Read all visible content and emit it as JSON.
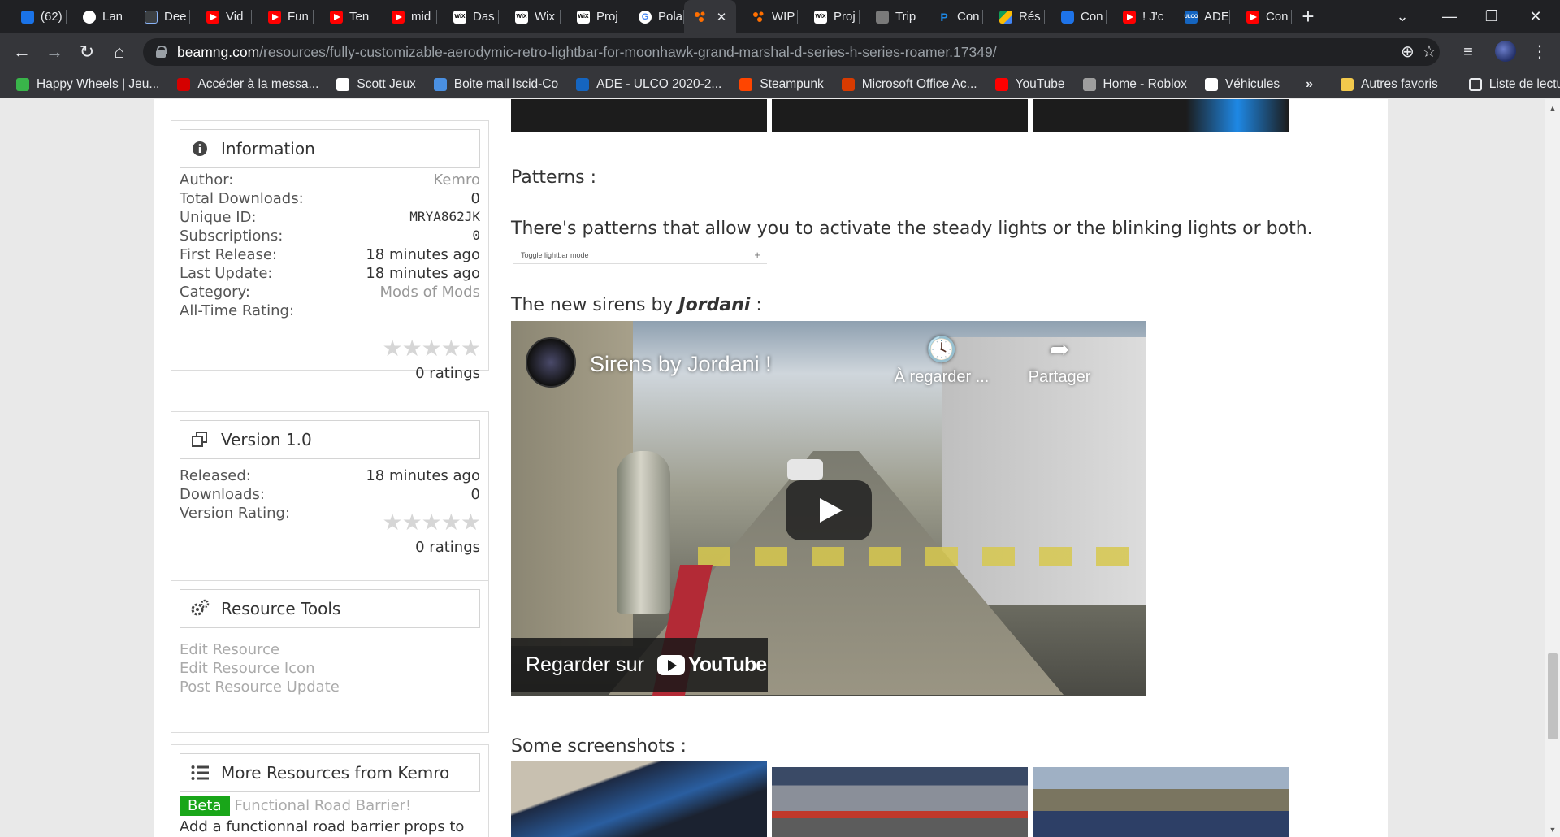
{
  "tabs": [
    {
      "label": "(62)",
      "icon": "avatar-icon",
      "cls": "fi-blue"
    },
    {
      "label": "Lan",
      "icon": "globe-icon",
      "cls": "fi-globe"
    },
    {
      "label": "Dee",
      "icon": "deepl-icon",
      "cls": "fi-dark"
    },
    {
      "label": "Vid",
      "icon": "youtube-icon",
      "cls": "fi-yt"
    },
    {
      "label": "Fun",
      "icon": "youtube-icon",
      "cls": "fi-yt"
    },
    {
      "label": "Ten",
      "icon": "youtube-icon",
      "cls": "fi-yt"
    },
    {
      "label": "mid",
      "icon": "youtube-icon",
      "cls": "fi-yt"
    },
    {
      "label": "Das",
      "icon": "wix-icon",
      "cls": "fi-wix"
    },
    {
      "label": "Wix",
      "icon": "wix-icon",
      "cls": "fi-wix"
    },
    {
      "label": "Proj",
      "icon": "wix-icon",
      "cls": "fi-wix"
    },
    {
      "label": "Pola",
      "icon": "google-icon",
      "cls": "fi-g"
    },
    {
      "label": "",
      "icon": "beamng-icon",
      "cls": "fi-orange",
      "active": true
    },
    {
      "label": "WIP",
      "icon": "beamng-icon",
      "cls": "fi-orange"
    },
    {
      "label": "Proj",
      "icon": "wix-icon",
      "cls": "fi-wix"
    },
    {
      "label": "Trip",
      "icon": "trip-icon",
      "cls": "fi-trip"
    },
    {
      "label": "Con",
      "icon": "paypal-icon",
      "cls": "fi-pp"
    },
    {
      "label": "Rés",
      "icon": "drive-icon",
      "cls": "fi-drive"
    },
    {
      "label": "Con",
      "icon": "meet-icon",
      "cls": "fi-cam"
    },
    {
      "label": "! J'c",
      "icon": "youtube-icon",
      "cls": "fi-yt"
    },
    {
      "label": "ADE",
      "icon": "ulco-icon",
      "cls": "fi-ulco"
    },
    {
      "label": "Con",
      "icon": "youtube-icon",
      "cls": "fi-yt"
    }
  ],
  "url": {
    "host": "beamng.com",
    "path": "/resources/fully-customizable-aerodymic-retro-lightbar-for-moonhawk-grand-marshal-d-series-h-series-roamer.17349/"
  },
  "bookmarks": [
    {
      "label": "Happy Wheels | Jeu...",
      "color": "#39b54a"
    },
    {
      "label": "Accéder à la messa...",
      "color": "#d50000"
    },
    {
      "label": "Scott Jeux",
      "color": "#ffffff"
    },
    {
      "label": "Boite mail lscid-Co",
      "color": "#4a90e2"
    },
    {
      "label": "ADE - ULCO 2020-2...",
      "color": "#1565c0"
    },
    {
      "label": "Steampunk",
      "color": "#ff4500"
    },
    {
      "label": "Microsoft Office Ac...",
      "color": "#d83b01"
    },
    {
      "label": "YouTube",
      "color": "#ff0000"
    },
    {
      "label": "Home - Roblox",
      "color": "#9e9e9e"
    },
    {
      "label": "Véhicules",
      "color": "#ffffff"
    }
  ],
  "bookmarks_more": "»",
  "other_bookmarks": "Autres favoris",
  "reading_list": "Liste de lecture",
  "information": {
    "title": "Information",
    "rows": [
      {
        "k": "Author:",
        "v": "Kemro"
      },
      {
        "k": "Total Downloads:",
        "v": "0"
      },
      {
        "k": "Unique ID:",
        "v": "MRYA862JK"
      },
      {
        "k": "Subscriptions:",
        "v": "0"
      },
      {
        "k": "First Release:",
        "v": "18 minutes ago"
      },
      {
        "k": "Last Update:",
        "v": "18 minutes ago"
      },
      {
        "k": "Category:",
        "v": "Mods of Mods"
      },
      {
        "k": "All-Time Rating:",
        "v": ""
      }
    ],
    "ratings": "0 ratings",
    "rating_value": 0,
    "rating_max": 5
  },
  "version": {
    "title": "Version 1.0",
    "rows": [
      {
        "k": "Released:",
        "v": "18 minutes ago"
      },
      {
        "k": "Downloads:",
        "v": "0"
      },
      {
        "k": "Version Rating:",
        "v": ""
      }
    ],
    "ratings": "0 ratings",
    "rating_value": 0,
    "rating_max": 5
  },
  "tools": {
    "title": "Resource Tools",
    "links": [
      "Edit Resource",
      "Edit Resource Icon",
      "Post Resource Update"
    ]
  },
  "more": {
    "title": "More Resources from Kemro",
    "badge": "Beta",
    "item_title": "Functional Road Barrier!",
    "item_desc": "Add a functionnal road barrier props to"
  },
  "main": {
    "patterns_heading": "Patterns :",
    "patterns_text": "There's patterns that allow you to activate the steady lights or the blinking lights or both.",
    "toggle_label": "Toggle lightbar mode",
    "toggle_plus": "+",
    "sirens_prefix": "The new sirens by ",
    "sirens_author": "Jordani",
    "sirens_suffix": " :",
    "screenshots_heading": "Some screenshots :"
  },
  "video": {
    "title": "Sirens by Jordani !",
    "watch_later": "À regarder ...",
    "share": "Partager",
    "watch_on": "Regarder sur",
    "youtube": "YouTube"
  },
  "colors": {
    "beta": "#19a619",
    "link_muted": "#aaaaaa",
    "chrome_dark": "#202124",
    "chrome_mid": "#35363a"
  }
}
